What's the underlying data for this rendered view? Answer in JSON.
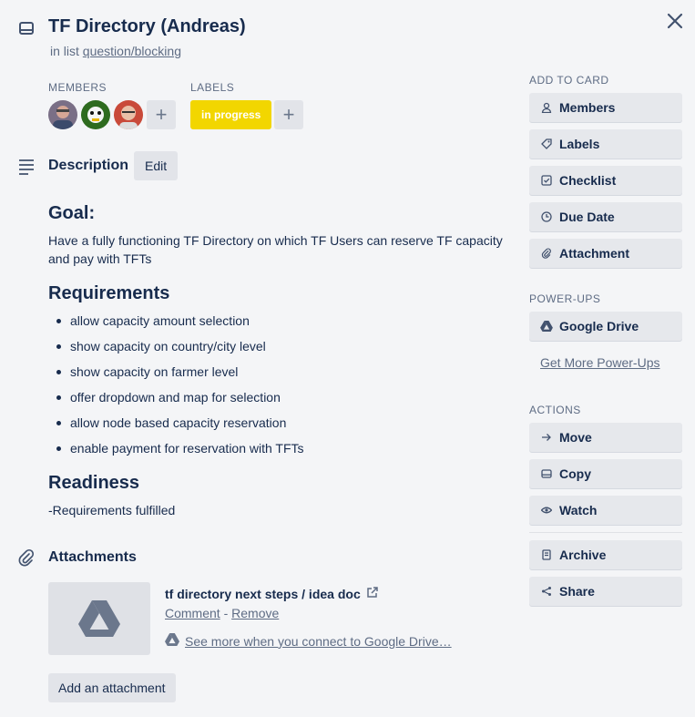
{
  "card": {
    "title": "TF Directory (Andreas)",
    "in_list_prefix": "in list",
    "list_name": "question/blocking"
  },
  "members": {
    "label": "MEMBERS",
    "avatars": [
      "member-1",
      "member-2",
      "member-3"
    ],
    "add_symbol": "+"
  },
  "labels": {
    "label": "LABELS",
    "items": [
      {
        "text": "in progress",
        "color": "#f2d600"
      }
    ],
    "add_symbol": "+"
  },
  "description": {
    "heading": "Description",
    "edit_label": "Edit",
    "goal_heading": "Goal:",
    "goal_text": "Have a fully functioning TF Directory on which TF Users can reserve TF capacity and pay with TFTs",
    "requirements_heading": "Requirements",
    "requirements": [
      "allow capacity amount selection",
      "show capacity on country/city level",
      "show capacity on farmer level",
      "offer dropdown and map for selection",
      "allow node based capacity reservation",
      "enable payment for reservation with TFTs"
    ],
    "readiness_heading": "Readiness",
    "readiness_text": "-Requirements fulfilled"
  },
  "attachments": {
    "heading": "Attachments",
    "item": {
      "name": "tf directory next steps / idea doc",
      "comment_label": "Comment",
      "separator": "-",
      "remove_label": "Remove",
      "gdrive_text": "See more when you connect to Google Drive…"
    },
    "add_label": "Add an attachment"
  },
  "sidebar": {
    "add_to_card_label": "ADD TO CARD",
    "add_to_card": [
      {
        "label": "Members",
        "icon": "person-icon"
      },
      {
        "label": "Labels",
        "icon": "tag-icon"
      },
      {
        "label": "Checklist",
        "icon": "checklist-icon"
      },
      {
        "label": "Due Date",
        "icon": "clock-icon"
      },
      {
        "label": "Attachment",
        "icon": "paperclip-icon"
      }
    ],
    "powerups_label": "POWER-UPS",
    "powerups": [
      {
        "label": "Google Drive",
        "icon": "google-drive-icon"
      }
    ],
    "more_powerups_label": "Get More Power-Ups",
    "actions_label": "ACTIONS",
    "actions": [
      {
        "label": "Move",
        "icon": "arrow-right-icon"
      },
      {
        "label": "Copy",
        "icon": "card-icon"
      },
      {
        "label": "Watch",
        "icon": "eye-icon"
      }
    ],
    "actions_2": [
      {
        "label": "Archive",
        "icon": "archive-icon"
      },
      {
        "label": "Share",
        "icon": "share-icon"
      }
    ]
  },
  "colors": {
    "background": "#f4f5f7",
    "text": "#172b4d",
    "muted": "#5e6c84",
    "label_yellow": "#f2d600",
    "button": "#e6e8ec"
  }
}
